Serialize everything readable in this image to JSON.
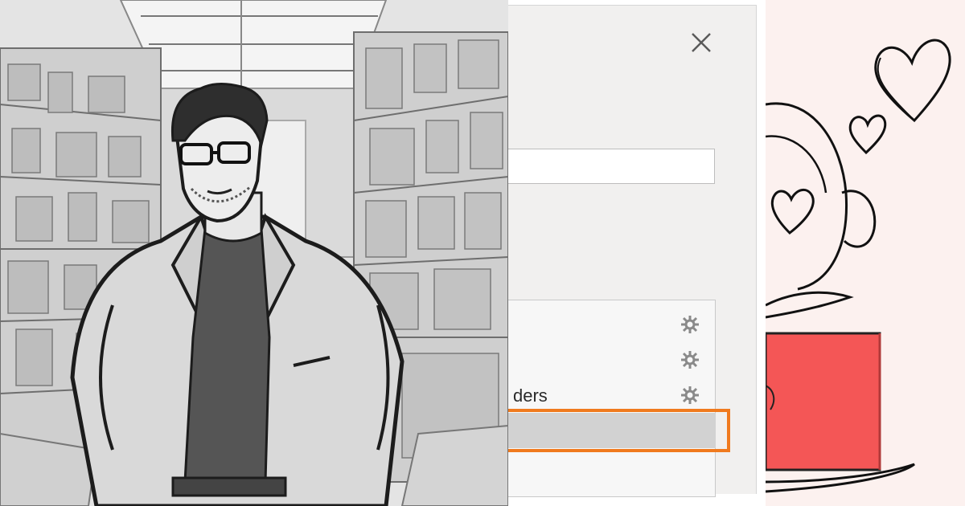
{
  "panels": {
    "left": {
      "illustration": "man-in-cluttered-storage-room-sketch"
    },
    "middle": {
      "dialog": {
        "close_icon": "close-icon",
        "text_input_value": "",
        "list_items": [
          {
            "label": "",
            "icon": "gear-icon"
          },
          {
            "label": "",
            "icon": "gear-icon"
          },
          {
            "label": "ders",
            "icon": "gear-icon"
          },
          {
            "label": "",
            "icon": ""
          }
        ],
        "highlight_color": "#f07a1e"
      }
    },
    "right": {
      "illustration": "hearts-and-red-box-doodle",
      "accent_color": "#f45656"
    }
  }
}
